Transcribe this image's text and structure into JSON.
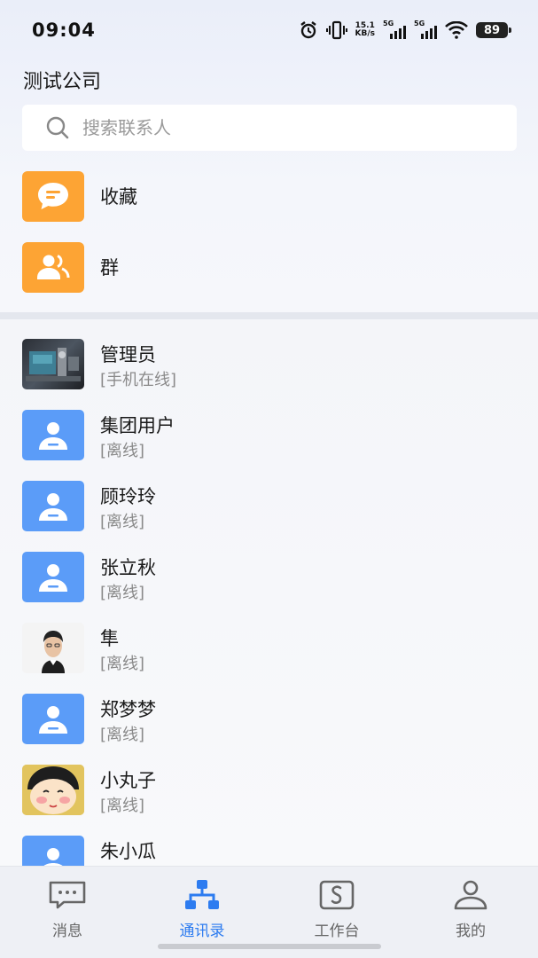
{
  "status_bar": {
    "time": "09:04",
    "net_speed_value": "15.1",
    "net_speed_unit": "KB/s",
    "signal1_label": "5G",
    "signal2_label": "5G",
    "battery": "89"
  },
  "header": {
    "company": "测试公司"
  },
  "search": {
    "placeholder": "搜索联系人"
  },
  "quick_entries": [
    {
      "label": "收藏",
      "icon": "chat-bubble-icon"
    },
    {
      "label": "群",
      "icon": "group-icon"
    }
  ],
  "contacts": [
    {
      "name": "管理员",
      "status": "[手机在线]",
      "avatar": "machine-photo"
    },
    {
      "name": "集团用户",
      "status": "[离线]",
      "avatar": "default-user-icon"
    },
    {
      "name": "顾玲玲",
      "status": "[离线]",
      "avatar": "default-user-icon"
    },
    {
      "name": "张立秋",
      "status": "[离线]",
      "avatar": "default-user-icon"
    },
    {
      "name": "隼",
      "status": "[离线]",
      "avatar": "person-photo"
    },
    {
      "name": "郑梦梦",
      "status": "[离线]",
      "avatar": "default-user-icon"
    },
    {
      "name": "小丸子",
      "status": "[离线]",
      "avatar": "cartoon-photo"
    },
    {
      "name": "朱小瓜",
      "status": "",
      "avatar": "default-user-icon"
    }
  ],
  "bottom_nav": {
    "items": [
      {
        "label": "消息",
        "icon": "message-icon"
      },
      {
        "label": "通讯录",
        "icon": "org-chart-icon"
      },
      {
        "label": "工作台",
        "icon": "workbench-icon"
      },
      {
        "label": "我的",
        "icon": "profile-icon"
      }
    ],
    "active_index": 1
  },
  "colors": {
    "accent": "#2d7cf0",
    "quick_icon_bg": "#fda434",
    "default_avatar_bg": "#5b9cf8"
  }
}
